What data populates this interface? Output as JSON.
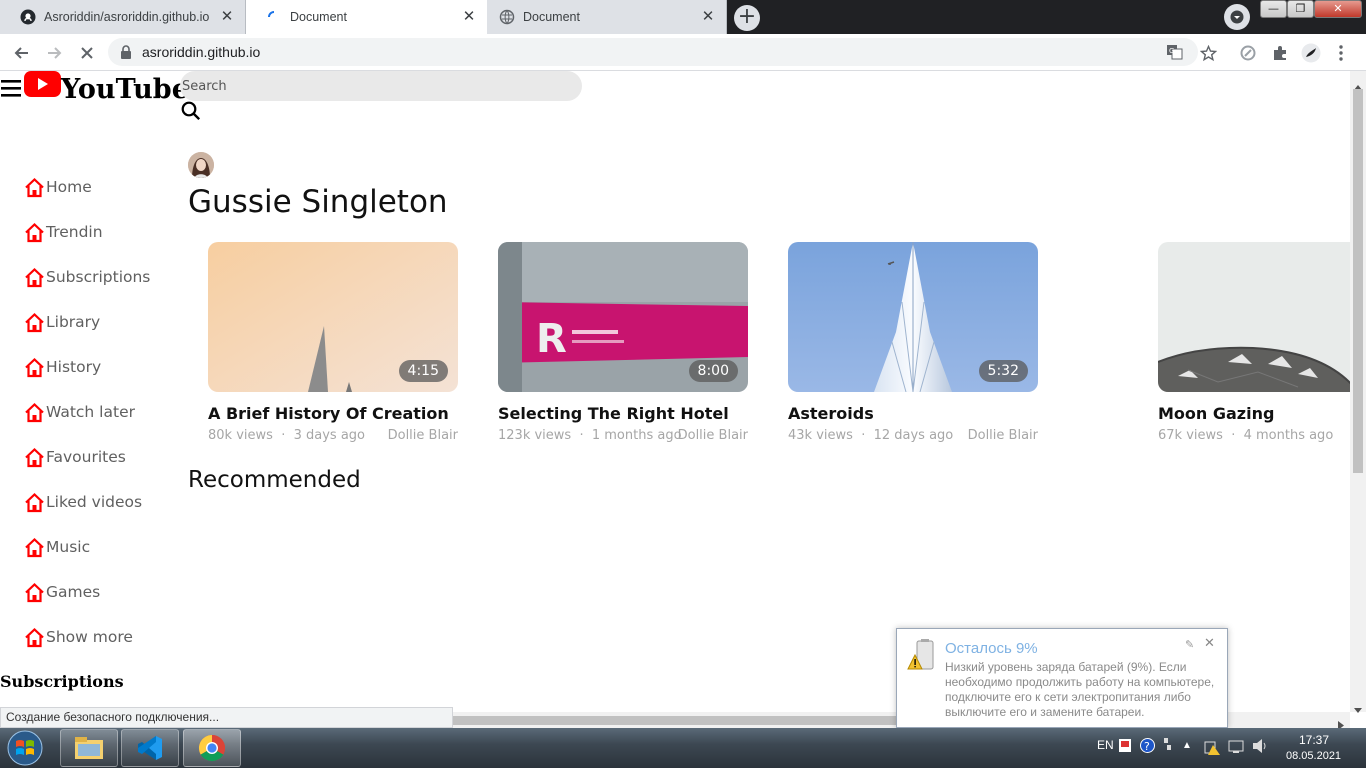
{
  "browser": {
    "tabs": [
      {
        "title": "Asroriddin/asroriddin.github.io",
        "icon": "github-icon",
        "active": false
      },
      {
        "title": "Document",
        "icon": "loading-icon",
        "active": true
      },
      {
        "title": "Document",
        "icon": "globe-icon",
        "active": false
      }
    ],
    "url": "asroriddin.github.io",
    "status_text": "Создание безопасного подключения..."
  },
  "header": {
    "logo_text": "YouTube",
    "search_placeholder": "Search"
  },
  "sidebar": {
    "items": [
      {
        "label": "Home",
        "icon": "home-icon"
      },
      {
        "label": "Trendin",
        "icon": "home-icon"
      },
      {
        "label": "Subscriptions",
        "icon": "home-icon"
      },
      {
        "label": "Library",
        "icon": "home-icon"
      },
      {
        "label": "History",
        "icon": "home-icon"
      },
      {
        "label": "Watch later",
        "icon": "home-icon"
      },
      {
        "label": "Favourites",
        "icon": "home-icon"
      },
      {
        "label": "Liked videos",
        "icon": "home-icon"
      },
      {
        "label": "Music",
        "icon": "home-icon"
      },
      {
        "label": "Games",
        "icon": "home-icon"
      },
      {
        "label": "Show more",
        "icon": "home-icon"
      }
    ],
    "subscriptions_heading": "Subscriptions"
  },
  "channel": {
    "name": "Gussie Singleton"
  },
  "videos": [
    {
      "title": "A Brief History Of Creation",
      "views": "80k views",
      "age": "3 days ago",
      "author": "Dollie Blair",
      "duration": "4:15"
    },
    {
      "title": "Selecting The Right Hotel",
      "views": "123k views",
      "age": "1 months ago",
      "author": "Dollie Blair",
      "duration": "8:00"
    },
    {
      "title": "Asteroids",
      "views": "43k views",
      "age": "12 days ago",
      "author": "Dollie Blair",
      "duration": "5:32"
    },
    {
      "title": "Moon Gazing",
      "views": "67k views",
      "age": "4 months ago",
      "author": "D",
      "duration": ""
    }
  ],
  "sections": {
    "recommended": "Recommended"
  },
  "notification": {
    "title": "Осталось 9%",
    "text": "Низкий уровень заряда батарей (9%). Если необходимо продолжить работу на компьютере, подключите его к сети электропитания либо выключите его и замените батареи."
  },
  "taskbar": {
    "language": "EN",
    "time": "17:37",
    "date": "08.05.2021"
  },
  "colors": {
    "accent_red": "#ff0000",
    "nav_text": "#606060",
    "meta_text": "#a6a6a6"
  }
}
